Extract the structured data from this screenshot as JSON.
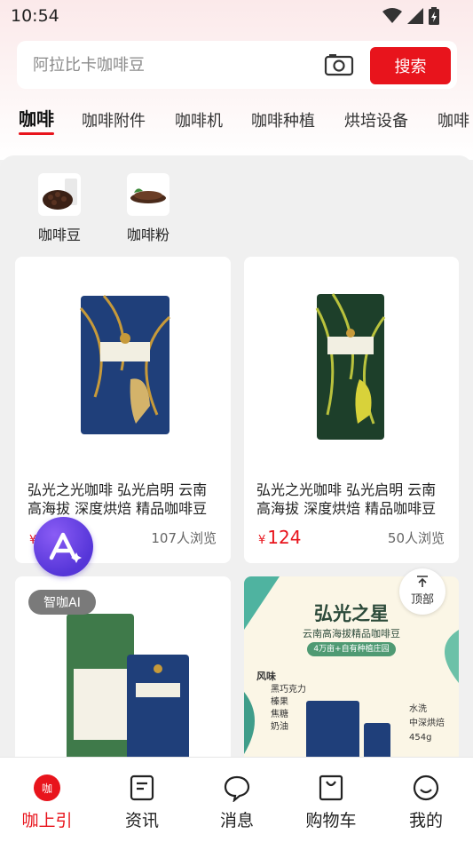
{
  "status": {
    "time": "10:54"
  },
  "search": {
    "placeholder": "阿拉比卡咖啡豆",
    "button_label": "搜索"
  },
  "tabs": [
    "咖啡",
    "咖啡附件",
    "咖啡机",
    "咖啡种植",
    "烘培设备",
    "咖啡"
  ],
  "categories": [
    {
      "label": "咖啡豆"
    },
    {
      "label": "咖啡粉"
    }
  ],
  "products": [
    {
      "title": "弘光之光咖啡 弘光启明 云南高海拔 深度烘焙 精品咖啡豆",
      "price_symbol": "¥",
      "price": "",
      "views": "107人浏览"
    },
    {
      "title": "弘光之光咖啡 弘光启明 云南高海拔 深度烘焙 精品咖啡豆",
      "price_symbol": "¥",
      "price": "124",
      "views": "50人浏览"
    }
  ],
  "promo": {
    "title": "弘光之星",
    "subtitle": "云南高海拔精品咖啡豆",
    "tagline": "4万亩+自有种植庄园",
    "flavor_heading": "风味",
    "flavors": [
      "黑巧克力",
      "榛果",
      "焦糖",
      "奶油"
    ],
    "process": [
      "水洗",
      "中深烘焙",
      "454g"
    ]
  },
  "ai_badge": "智咖AI",
  "back_to_top": "顶部",
  "nav": [
    {
      "label": "咖上引",
      "icon": "home-logo-icon"
    },
    {
      "label": "资讯",
      "icon": "news-icon"
    },
    {
      "label": "消息",
      "icon": "message-icon"
    },
    {
      "label": "购物车",
      "icon": "cart-icon"
    },
    {
      "label": "我的",
      "icon": "profile-icon"
    }
  ],
  "colors": {
    "accent": "#e8141c",
    "ai": "#5a3be0"
  }
}
